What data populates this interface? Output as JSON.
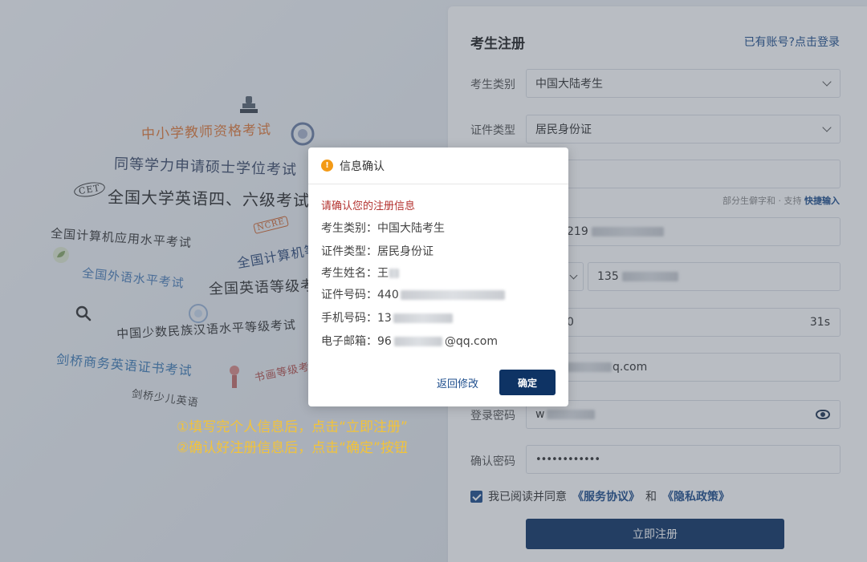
{
  "background": {
    "words": [
      "中小学教师资格考试",
      "同等学力申请硕士学位考试",
      "全国大学英语四、六级考试",
      "全国计算机应用水平考试",
      "全国计算机等级考试",
      "全国外语水平考试",
      "全国英语等级考试",
      "中国少数民族汉语水平等级考试",
      "剑桥商务英语证书考试",
      "书画等级考试",
      "剑桥少儿英语"
    ],
    "cet_badge": "CET",
    "ncre_badge": "NCRE"
  },
  "register": {
    "title": "考生注册",
    "login_link": "已有账号?点击登录",
    "category_label": "考生类别",
    "category_value": "中国大陆考生",
    "idtype_label": "证件类型",
    "idtype_value": "居民身份证",
    "name_hint_prefix": "部分生僻字和 · 支持",
    "name_hint_link": "快捷输入",
    "id_value_prefix": "219",
    "phone_value_prefix": "135",
    "code_value_prefix": "0",
    "countdown": "31s",
    "email_value_suffix": "q.com",
    "login_pwd_label": "登录密码",
    "login_pwd_value_prefix": "w",
    "confirm_pwd_label": "确认密码",
    "confirm_pwd_value": "••••••••••••",
    "agree_prefix": "我已阅读并同意",
    "agree_service": "《服务协议》",
    "agree_and": "和",
    "agree_privacy": "《隐私政策》",
    "submit_label": "立即注册"
  },
  "instructions": [
    "①填写完个人信息后，点击“立即注册”",
    "②确认好注册信息后，点击“确定”按钮"
  ],
  "modal": {
    "title": "信息确认",
    "note": "请确认您的注册信息",
    "rows": [
      {
        "label": "考生类别：",
        "value": "中国大陆考生"
      },
      {
        "label": "证件类型：",
        "value": "居民身份证"
      },
      {
        "label": "考生姓名：",
        "value": "王"
      },
      {
        "label": "证件号码：",
        "value": "440"
      },
      {
        "label": "手机号码：",
        "value": "13"
      },
      {
        "label": "电子邮箱：",
        "value": "96",
        "suffix": "@qq.com"
      }
    ],
    "back_label": "返回修改",
    "ok_label": "确定"
  },
  "colors": {
    "primary": "#0e3364",
    "link": "#1d4d8c",
    "warning": "#f39a16",
    "note_red": "#b3312e",
    "instruction_yellow": "#f2c33a"
  }
}
